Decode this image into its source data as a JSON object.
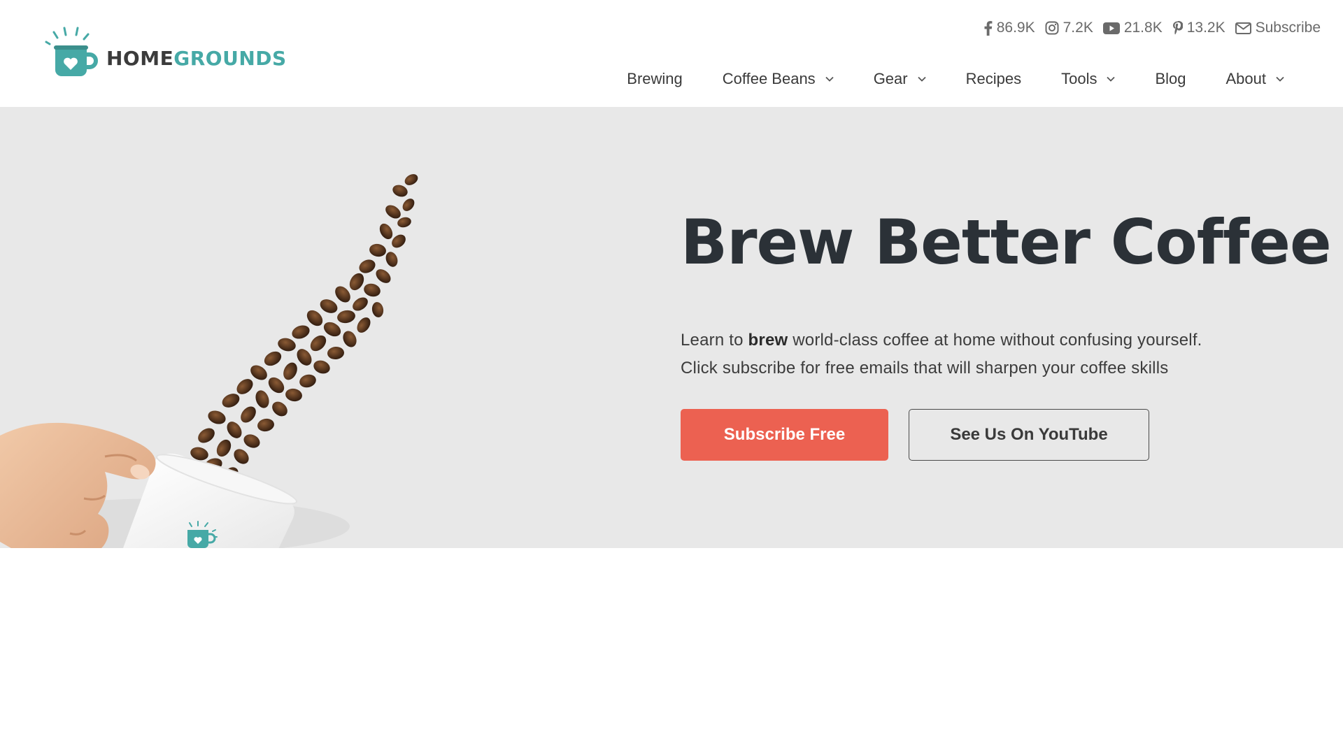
{
  "brand": {
    "name_part1": "HOME",
    "name_part2": "GROUNDS",
    "colors": {
      "teal": "#46a9a6",
      "dark": "#3b3b3b",
      "accent": "#ec6151"
    }
  },
  "social": [
    {
      "icon": "facebook-icon",
      "count": "86.9K"
    },
    {
      "icon": "instagram-icon",
      "count": "7.2K"
    },
    {
      "icon": "youtube-icon",
      "count": "21.8K"
    },
    {
      "icon": "pinterest-icon",
      "count": "13.2K"
    },
    {
      "icon": "mail-icon",
      "count": "Subscribe"
    }
  ],
  "nav": {
    "items": [
      {
        "label": "Brewing",
        "has_dropdown": false
      },
      {
        "label": "Coffee Beans",
        "has_dropdown": true
      },
      {
        "label": "Gear",
        "has_dropdown": true
      },
      {
        "label": "Recipes",
        "has_dropdown": false
      },
      {
        "label": "Tools",
        "has_dropdown": true
      },
      {
        "label": "Blog",
        "has_dropdown": false
      },
      {
        "label": "About",
        "has_dropdown": true
      }
    ]
  },
  "hero": {
    "title": "Brew Better Coffee",
    "line1_before": "Learn to ",
    "line1_bold": "brew",
    "line1_after": " world-class coffee at home without confusing yourself.",
    "line2": "Click subscribe for free emails that will sharpen your coffee skills",
    "primary_button": "Subscribe Free",
    "secondary_button": "See Us On YouTube"
  }
}
